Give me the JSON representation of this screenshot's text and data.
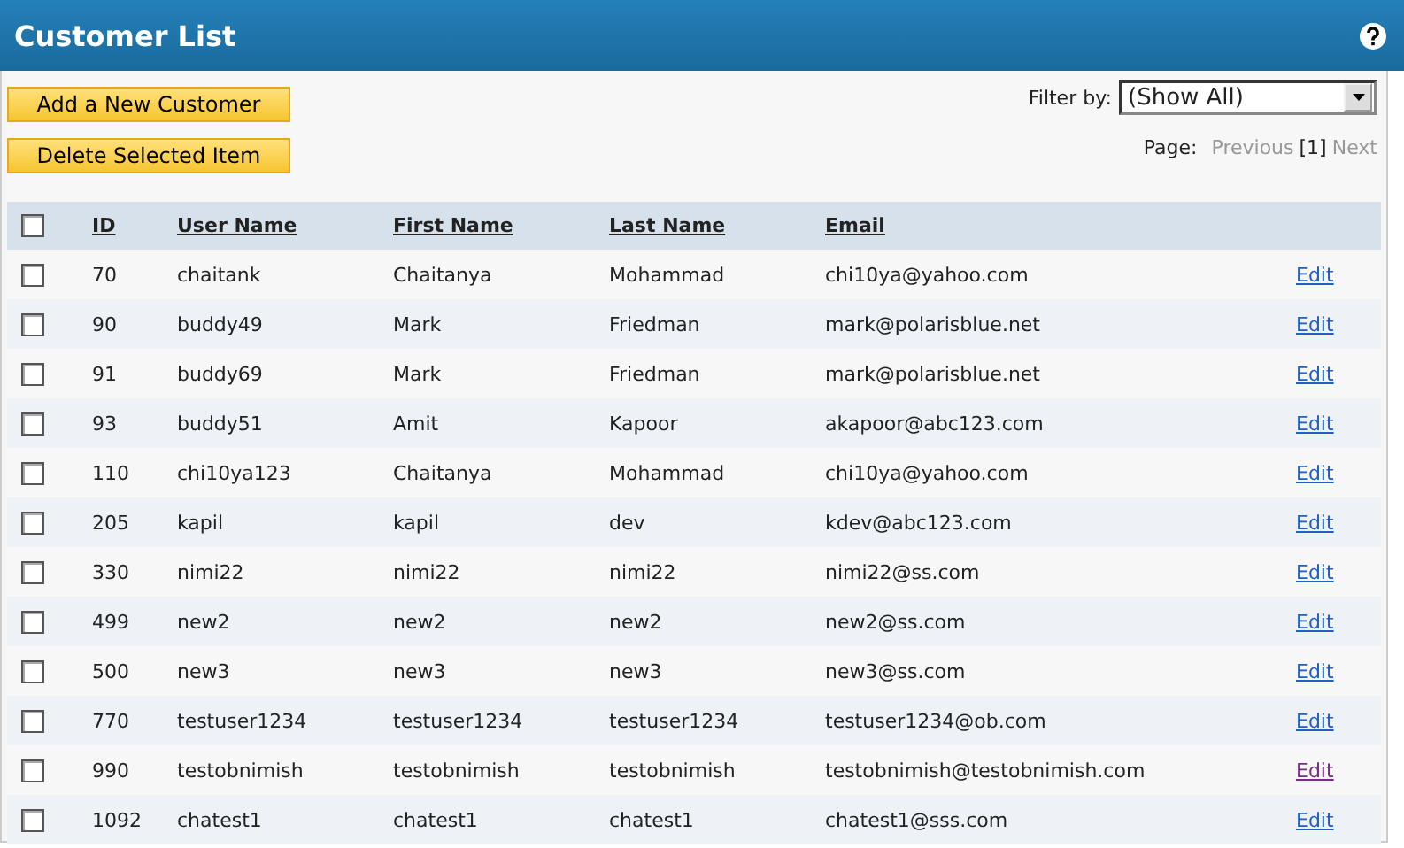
{
  "window": {
    "title": "Customer List"
  },
  "buttons": [
    "Add a New Customer",
    "Delete Selected Item"
  ],
  "filter": {
    "label": "Filter by:",
    "value": "(Show All)"
  },
  "pager": {
    "label": "Page:",
    "previous": "Previous",
    "current": "[1]",
    "next": "Next"
  },
  "table": {
    "select_all": {
      "checked": false
    },
    "columns": [
      "ID",
      "User Name",
      "First Name",
      "Last Name",
      "Email"
    ],
    "rows": [
      {
        "checked": false,
        "cells": [
          "70",
          "chaitank",
          "Chaitanya",
          "Mohammad",
          "chi10ya@yahoo.com"
        ],
        "action": "Edit",
        "visited": false
      },
      {
        "checked": false,
        "cells": [
          "90",
          "buddy49",
          "Mark",
          "Friedman",
          "mark@polarisblue.net"
        ],
        "action": "Edit",
        "visited": false
      },
      {
        "checked": false,
        "cells": [
          "91",
          "buddy69",
          "Mark",
          "Friedman",
          "mark@polarisblue.net"
        ],
        "action": "Edit",
        "visited": false
      },
      {
        "checked": false,
        "cells": [
          "93",
          "buddy51",
          "Amit",
          "Kapoor",
          "akapoor@abc123.com"
        ],
        "action": "Edit",
        "visited": false
      },
      {
        "checked": false,
        "cells": [
          "110",
          "chi10ya123",
          "Chaitanya",
          "Mohammad",
          "chi10ya@yahoo.com"
        ],
        "action": "Edit",
        "visited": false
      },
      {
        "checked": false,
        "cells": [
          "205",
          "kapil",
          "kapil",
          "dev",
          "kdev@abc123.com"
        ],
        "action": "Edit",
        "visited": false
      },
      {
        "checked": false,
        "cells": [
          "330",
          "nimi22",
          "nimi22",
          "nimi22",
          "nimi22@ss.com"
        ],
        "action": "Edit",
        "visited": false
      },
      {
        "checked": false,
        "cells": [
          "499",
          "new2",
          "new2",
          "new2",
          "new2@ss.com"
        ],
        "action": "Edit",
        "visited": false
      },
      {
        "checked": false,
        "cells": [
          "500",
          "new3",
          "new3",
          "new3",
          "new3@ss.com"
        ],
        "action": "Edit",
        "visited": false
      },
      {
        "checked": false,
        "cells": [
          "770",
          "testuser1234",
          "testuser1234",
          "testuser1234",
          "testuser1234@ob.com"
        ],
        "action": "Edit",
        "visited": false
      },
      {
        "checked": false,
        "cells": [
          "990",
          "testobnimish",
          "testobnimish",
          "testobnimish",
          "testobnimish@testobnimish.com"
        ],
        "action": "Edit",
        "visited": true
      },
      {
        "checked": false,
        "cells": [
          "1092",
          "chatest1",
          "chatest1",
          "chatest1",
          "chatest1@sss.com"
        ],
        "action": "Edit",
        "visited": false
      }
    ]
  }
}
